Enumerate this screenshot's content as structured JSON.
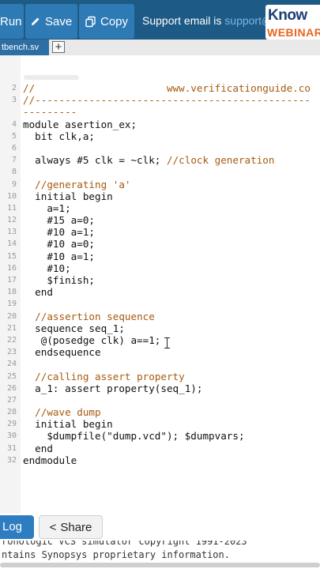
{
  "toolbar": {
    "run_label": "Run",
    "save_label": "Save",
    "copy_label": "Copy",
    "support_text": "Support email is ",
    "support_link": "support@",
    "logo_top": "Know",
    "logo_bottom": "WEBINAR"
  },
  "tabs": {
    "active_file": "tbench.sv",
    "add_symbol": "+"
  },
  "code_lines": [
    {
      "n": "2",
      "t": "//                      www.verificationguide.co"
    },
    {
      "n": "3",
      "t": "//----------------------------------------------"
    },
    {
      "n": "",
      "t": "---------"
    },
    {
      "n": "4",
      "t": "module asertion_ex;"
    },
    {
      "n": "5",
      "t": "  bit clk,a;"
    },
    {
      "n": "6",
      "t": ""
    },
    {
      "n": "7",
      "t": "  always #5 clk = ~clk; //clock generation"
    },
    {
      "n": "8",
      "t": ""
    },
    {
      "n": "9",
      "t": "  //generating 'a'"
    },
    {
      "n": "10",
      "t": "  initial begin"
    },
    {
      "n": "11",
      "t": "    a=1;"
    },
    {
      "n": "12",
      "t": "    #15 a=0;"
    },
    {
      "n": "13",
      "t": "    #10 a=1;"
    },
    {
      "n": "14",
      "t": "    #10 a=0;"
    },
    {
      "n": "15",
      "t": "    #10 a=1;"
    },
    {
      "n": "16",
      "t": "    #10;"
    },
    {
      "n": "17",
      "t": "    $finish;"
    },
    {
      "n": "18",
      "t": "  end"
    },
    {
      "n": "19",
      "t": ""
    },
    {
      "n": "20",
      "t": "  //assertion sequence"
    },
    {
      "n": "21",
      "t": "  sequence seq_1;"
    },
    {
      "n": "22",
      "t": "   @(posedge clk) a==1;"
    },
    {
      "n": "23",
      "t": "  endsequence"
    },
    {
      "n": "24",
      "t": ""
    },
    {
      "n": "25",
      "t": "  //calling assert property"
    },
    {
      "n": "26",
      "t": "  a_1: assert property(seq_1);"
    },
    {
      "n": "27",
      "t": ""
    },
    {
      "n": "28",
      "t": "  //wave dump"
    },
    {
      "n": "29",
      "t": "  initial begin"
    },
    {
      "n": "30",
      "t": "    $dumpfile(\"dump.vcd\"); $dumpvars;"
    },
    {
      "n": "31",
      "t": "  end"
    },
    {
      "n": "32",
      "t": "endmodule"
    }
  ],
  "bottom": {
    "log_label": "Log",
    "share_label": "Share"
  },
  "console": {
    "line1": "ronologic VCS simulator copyright 1991-2023",
    "line2": "ntains Synopsys proprietary information."
  },
  "colors": {
    "toolbar_bg": "#1d5a85",
    "button_bg": "#2e7ab5",
    "comment": "#a65a10",
    "keyword": "#1b49a8"
  }
}
